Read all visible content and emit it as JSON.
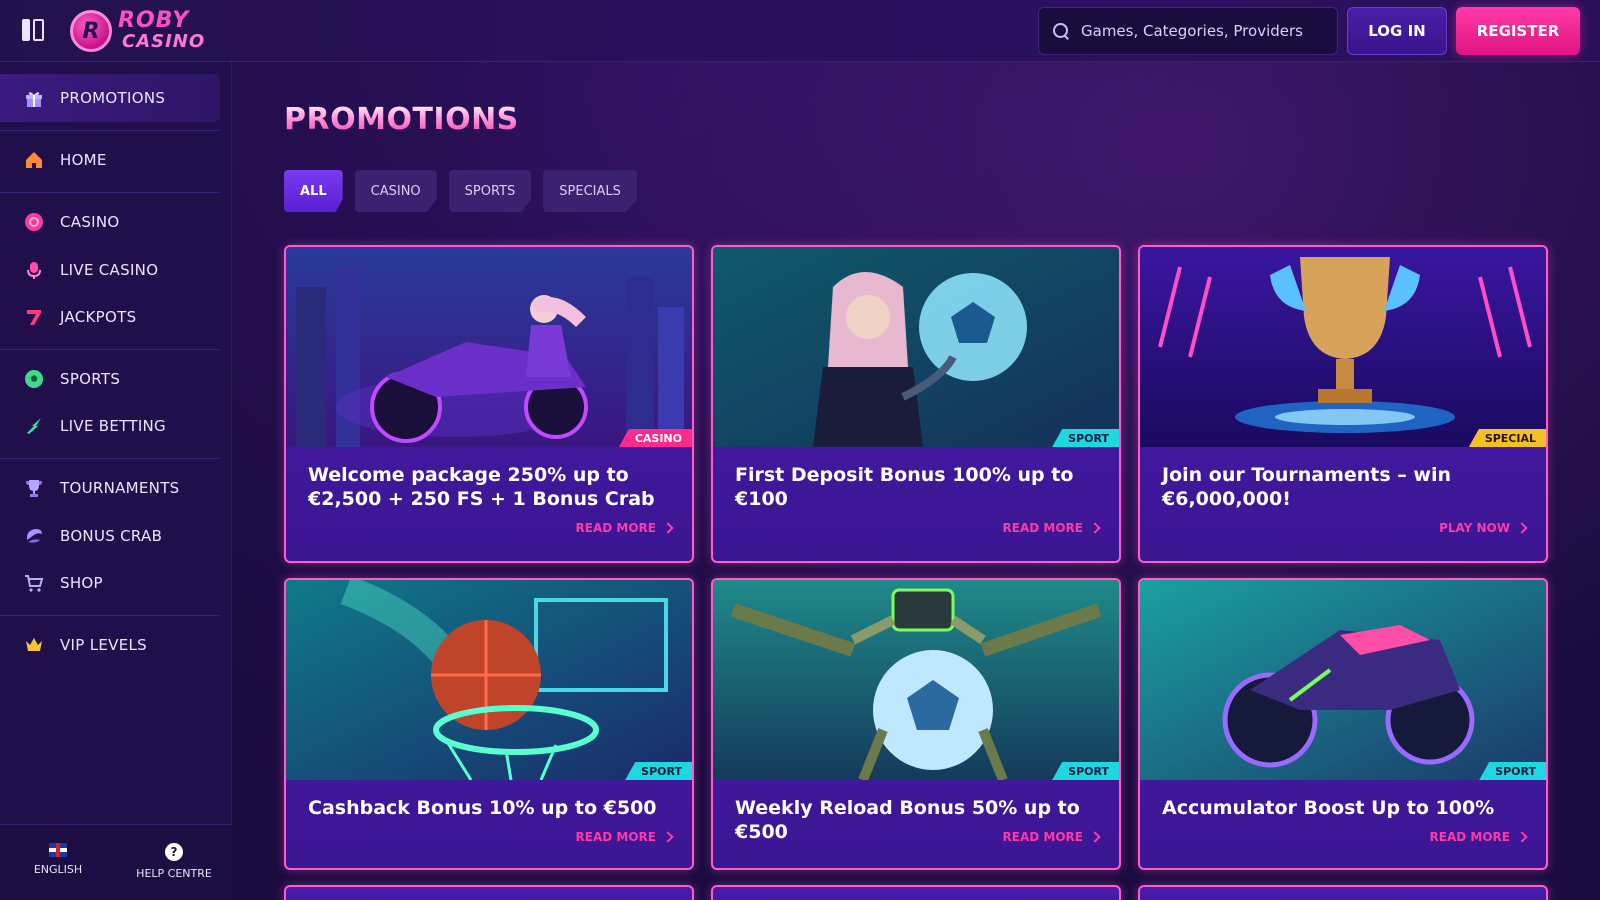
{
  "brand": {
    "line1": "ROBY",
    "line2": "CASINO",
    "badge_letter": "R"
  },
  "search": {
    "placeholder": "Games, Categories, Providers"
  },
  "auth": {
    "login_label": "LOG IN",
    "register_label": "REGISTER"
  },
  "sidebar": {
    "items": [
      {
        "label": "PROMOTIONS",
        "icon": "gift-icon",
        "active": true
      },
      {
        "label": "HOME",
        "icon": "home-icon"
      },
      {
        "label": "CASINO",
        "icon": "casino-chip-icon"
      },
      {
        "label": "LIVE CASINO",
        "icon": "microphone-icon"
      },
      {
        "label": "JACKPOTS",
        "icon": "lucky-seven-icon"
      },
      {
        "label": "SPORTS",
        "icon": "soccer-ball-icon"
      },
      {
        "label": "LIVE BETTING",
        "icon": "lightning-icon"
      },
      {
        "label": "TOURNAMENTS",
        "icon": "trophy-icon"
      },
      {
        "label": "BONUS CRAB",
        "icon": "crab-icon"
      },
      {
        "label": "SHOP",
        "icon": "cart-icon"
      },
      {
        "label": "VIP LEVELS",
        "icon": "crown-icon"
      }
    ],
    "footer": {
      "language_label": "ENGLISH",
      "help_label": "HELP CENTRE",
      "help_glyph": "?"
    }
  },
  "main": {
    "title": "PROMOTIONS",
    "tabs": [
      {
        "label": "ALL",
        "active": true
      },
      {
        "label": "CASINO"
      },
      {
        "label": "SPORTS"
      },
      {
        "label": "SPECIALS"
      }
    ],
    "cards": [
      {
        "title": "Welcome package 250% up to €2,500 + 250 FS + 1 Bonus Crab",
        "badge": "CASINO",
        "cta": "READ MORE"
      },
      {
        "title": "First Deposit Bonus 100% up to €100",
        "badge": "SPORT",
        "cta": "READ MORE"
      },
      {
        "title": "Join our Tournaments – win €6,000,000!",
        "badge": "SPECIAL",
        "cta": "PLAY NOW"
      },
      {
        "title": "Cashback Bonus 10% up to €500",
        "badge": "SPORT",
        "cta": "READ MORE"
      },
      {
        "title": "Weekly Reload Bonus 50% up to €500",
        "badge": "SPORT",
        "cta": "READ MORE"
      },
      {
        "title": "Accumulator Boost Up to 100%",
        "badge": "SPORT",
        "cta": "READ MORE"
      }
    ]
  },
  "colors": {
    "accent_pink": "#ff3aa6",
    "primary_purple": "#5a1fd0",
    "badge_sport": "#1ed7e0",
    "badge_special": "#f4c028",
    "badge_casino": "#ff2a8a"
  }
}
